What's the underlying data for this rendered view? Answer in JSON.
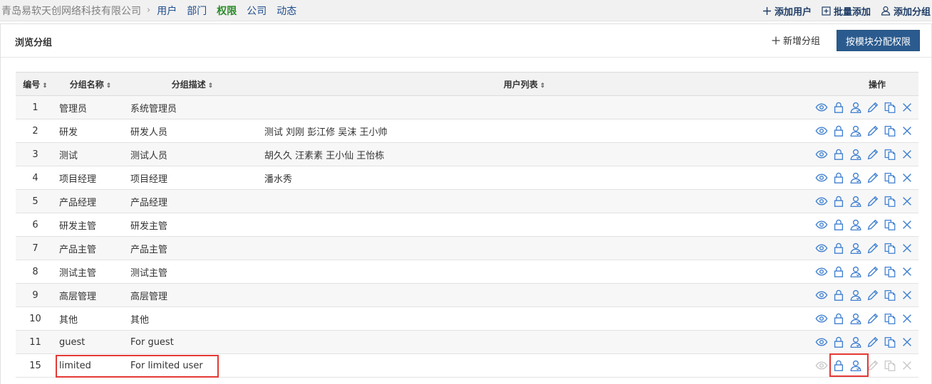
{
  "topbar": {
    "company": "青岛易软天创网络科技有限公司",
    "separator": "›",
    "nav": [
      "用户",
      "部门",
      "权限",
      "公司",
      "动态"
    ],
    "active_index": 2,
    "actions": {
      "add_user": "添加用户",
      "batch_add": "批量添加",
      "add_group": "添加分组"
    }
  },
  "panel": {
    "title": "浏览分组",
    "new_group": "新增分组",
    "assign_by_module": "按模块分配权限"
  },
  "table": {
    "headers": {
      "id": "编号",
      "name": "分组名称",
      "desc": "分组描述",
      "users": "用户列表",
      "ops": "操作"
    },
    "sort_glyph": "⇕",
    "rows": [
      {
        "id": "1",
        "name": "管理员",
        "desc": "系统管理员",
        "users": ""
      },
      {
        "id": "2",
        "name": "研发",
        "desc": "研发人员",
        "users": "测试 刘刚 彭江修 吴沫 王小帅"
      },
      {
        "id": "3",
        "name": "测试",
        "desc": "测试人员",
        "users": "胡久久 汪素素 王小仙 王怡栋"
      },
      {
        "id": "4",
        "name": "项目经理",
        "desc": "项目经理",
        "users": "潘水秀"
      },
      {
        "id": "5",
        "name": "产品经理",
        "desc": "产品经理",
        "users": ""
      },
      {
        "id": "6",
        "name": "研发主管",
        "desc": "研发主管",
        "users": ""
      },
      {
        "id": "7",
        "name": "产品主管",
        "desc": "产品主管",
        "users": ""
      },
      {
        "id": "8",
        "name": "测试主管",
        "desc": "测试主管",
        "users": ""
      },
      {
        "id": "9",
        "name": "高层管理",
        "desc": "高层管理",
        "users": ""
      },
      {
        "id": "10",
        "name": "其他",
        "desc": "其他",
        "users": ""
      },
      {
        "id": "11",
        "name": "guest",
        "desc": "For guest",
        "users": ""
      },
      {
        "id": "15",
        "name": "limited",
        "desc": "For limited user",
        "users": ""
      }
    ],
    "last_row_disabled_actions": [
      "view",
      "edit",
      "copy",
      "delete"
    ]
  },
  "colors": {
    "accent": "#2b5b8e",
    "icon": "#3f7fd0",
    "icon_disabled": "#c8c8c8",
    "nav_active": "#2a8a2a",
    "highlight": "#e53935"
  }
}
